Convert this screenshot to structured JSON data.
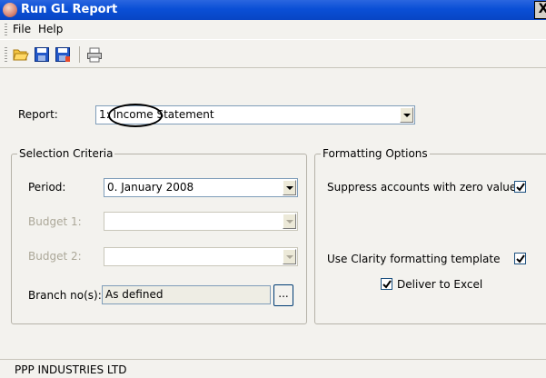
{
  "window": {
    "title": "Run GL Report",
    "close_glyph": "X"
  },
  "menu": {
    "file": "File",
    "help": "Help"
  },
  "toolbar": {
    "icons": [
      "open-folder-icon",
      "save-icon",
      "save-as-icon",
      "print-icon"
    ]
  },
  "report": {
    "label": "Report:",
    "value": "1: Income Statement"
  },
  "selection": {
    "title": "Selection Criteria",
    "period_label": "Period:",
    "period_value": "0. January 2008",
    "budget1_label": "Budget 1:",
    "budget1_value": "",
    "budget2_label": "Budget 2:",
    "budget2_value": "",
    "branch_label": "Branch no(s):",
    "branch_value": "As defined",
    "ellipsis": "..."
  },
  "formatting": {
    "title": "Formatting Options",
    "suppress_label": "Suppress accounts with zero values",
    "suppress_checked": true,
    "clarity_label": "Use Clarity formatting template",
    "clarity_checked": true,
    "excel_label": "Deliver to Excel",
    "excel_checked": true
  },
  "status": {
    "company": "PPP INDUSTRIES LTD"
  },
  "colors": {
    "title_bar": "#0a4fd6",
    "window_bg": "#f3f2ee",
    "disabled_text": "#aca899"
  }
}
